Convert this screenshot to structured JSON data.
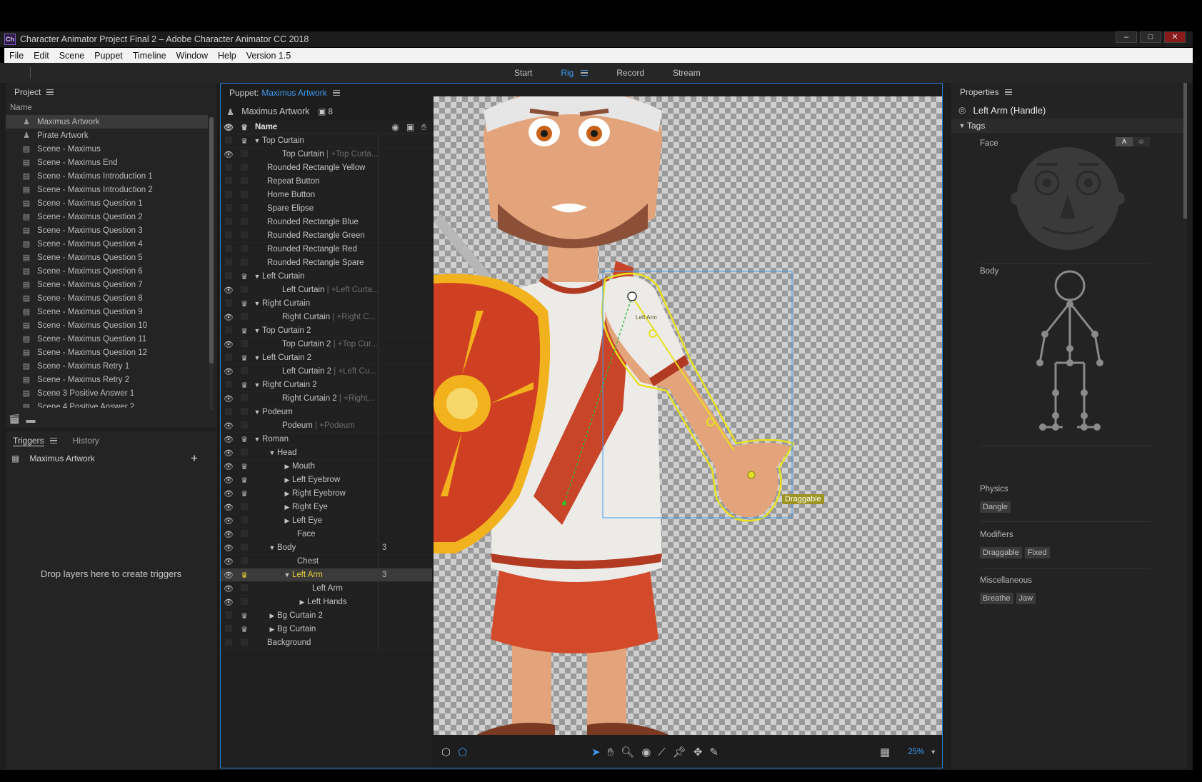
{
  "window": {
    "app_icon": "Ch",
    "title": "Character Animator Project Final 2 – Adobe Character Animator CC 2018",
    "controls": [
      "minimize-icon",
      "maximize-icon",
      "close-icon"
    ]
  },
  "menu": [
    "File",
    "Edit",
    "Scene",
    "Puppet",
    "Timeline",
    "Window",
    "Help",
    "Version 1.5"
  ],
  "workspaces": [
    {
      "label": "Start",
      "active": false
    },
    {
      "label": "Rig",
      "active": true
    },
    {
      "label": "Record",
      "active": false
    },
    {
      "label": "Stream",
      "active": false
    }
  ],
  "project": {
    "title": "Project",
    "column": "Name",
    "items": [
      {
        "label": "Maximus Artwork",
        "icon": "puppet-icon",
        "selected": true
      },
      {
        "label": "Pirate Artwork",
        "icon": "puppet-icon"
      },
      {
        "label": "Scene - Maximus",
        "icon": "scene-icon"
      },
      {
        "label": "Scene - Maximus End",
        "icon": "scene-icon"
      },
      {
        "label": "Scene - Maximus Introduction 1",
        "icon": "scene-icon"
      },
      {
        "label": "Scene - Maximus Introduction 2",
        "icon": "scene-icon"
      },
      {
        "label": "Scene - Maximus Question 1",
        "icon": "scene-icon"
      },
      {
        "label": "Scene - Maximus Question 2",
        "icon": "scene-icon"
      },
      {
        "label": "Scene - Maximus Question 3",
        "icon": "scene-icon"
      },
      {
        "label": "Scene - Maximus Question 4",
        "icon": "scene-icon"
      },
      {
        "label": "Scene - Maximus Question 5",
        "icon": "scene-icon"
      },
      {
        "label": "Scene - Maximus Question 6",
        "icon": "scene-icon"
      },
      {
        "label": "Scene - Maximus Question 7",
        "icon": "scene-icon"
      },
      {
        "label": "Scene - Maximus Question 8",
        "icon": "scene-icon"
      },
      {
        "label": "Scene - Maximus Question 9",
        "icon": "scene-icon"
      },
      {
        "label": "Scene - Maximus Question 10",
        "icon": "scene-icon"
      },
      {
        "label": "Scene - Maximus Question 11",
        "icon": "scene-icon"
      },
      {
        "label": "Scene - Maximus Question 12",
        "icon": "scene-icon"
      },
      {
        "label": "Scene - Maximus Retry 1",
        "icon": "scene-icon"
      },
      {
        "label": "Scene - Maximus Retry 2",
        "icon": "scene-icon"
      },
      {
        "label": "Scene 3 Positive Answer 1",
        "icon": "scene-icon"
      },
      {
        "label": "Scene 4 Positive Answer 2",
        "icon": "scene-icon"
      }
    ],
    "footer_icons": [
      "new-scene-icon",
      "folder-icon"
    ]
  },
  "triggers": {
    "tabs": [
      {
        "label": "Triggers",
        "active": true
      },
      {
        "label": "History",
        "active": false
      }
    ],
    "item": "Maximus Artwork",
    "hint": "Drop layers here to create triggers"
  },
  "puppet": {
    "title_prefix": "Puppet:",
    "name": "Maximus Artwork",
    "sub_name": "Maximus Artwork",
    "count": "8",
    "column_name": "Name",
    "layers": [
      {
        "label": "Top Curtain",
        "indent": 0,
        "caret": "open",
        "eye": false,
        "crown": true
      },
      {
        "label": "Top Curtain",
        "sub": "+Top Curta...",
        "indent": 2,
        "eye": true
      },
      {
        "label": "Rounded Rectangle Yellow",
        "indent": 1
      },
      {
        "label": "Repeat Button",
        "indent": 1
      },
      {
        "label": "Home Button",
        "indent": 1
      },
      {
        "label": "Spare Elipse",
        "indent": 1
      },
      {
        "label": "Rounded Rectangle Blue",
        "indent": 1
      },
      {
        "label": "Rounded Rectangle Green",
        "indent": 1
      },
      {
        "label": "Rounded Rectangle Red",
        "indent": 1
      },
      {
        "label": "Rounded Rectangle Spare",
        "indent": 1
      },
      {
        "label": "Left Curtain",
        "indent": 0,
        "caret": "open",
        "crown": true
      },
      {
        "label": "Left Curtain",
        "sub": "+Left Curta...",
        "indent": 2,
        "eye": true
      },
      {
        "label": "Right Curtain",
        "indent": 0,
        "caret": "open",
        "crown": true
      },
      {
        "label": "Right Curtain",
        "sub": "+Right C...",
        "indent": 2,
        "eye": true
      },
      {
        "label": "Top Curtain 2",
        "indent": 0,
        "caret": "open",
        "crown": true
      },
      {
        "label": "Top Curtain 2",
        "sub": "+Top Cur...",
        "indent": 2,
        "eye": true
      },
      {
        "label": "Left Curtain 2",
        "indent": 0,
        "caret": "open",
        "crown": true
      },
      {
        "label": "Left Curtain 2",
        "sub": "+Left Cu...",
        "indent": 2,
        "eye": true
      },
      {
        "label": "Right Curtain 2",
        "indent": 0,
        "caret": "open",
        "crown": true
      },
      {
        "label": "Right Curtain 2",
        "sub": "+Right...",
        "indent": 2,
        "eye": true
      },
      {
        "label": "Podeum",
        "indent": 0,
        "caret": "open"
      },
      {
        "label": "Podeum",
        "sub": "+Podeum",
        "indent": 2,
        "eye": true
      },
      {
        "label": "Roman",
        "indent": 0,
        "caret": "open",
        "eye": true,
        "crown": true
      },
      {
        "label": "Head",
        "indent": 1,
        "caret": "open",
        "eye": true
      },
      {
        "label": "Mouth",
        "indent": 2,
        "caret": "closed",
        "eye": true,
        "crown": true
      },
      {
        "label": "Left Eyebrow",
        "indent": 2,
        "caret": "closed",
        "eye": true,
        "crown": true
      },
      {
        "label": "Right Eyebrow",
        "indent": 2,
        "caret": "closed",
        "eye": true,
        "crown": true
      },
      {
        "label": "Right Eye",
        "indent": 2,
        "caret": "closed",
        "eye": true
      },
      {
        "label": "Left Eye",
        "indent": 2,
        "caret": "closed",
        "eye": true
      },
      {
        "label": "Face",
        "indent": 3,
        "eye": true
      },
      {
        "label": "Body",
        "indent": 1,
        "caret": "open",
        "eye": true,
        "num": "3"
      },
      {
        "label": "Chest",
        "indent": 3,
        "eye": true
      },
      {
        "label": "Left Arm",
        "indent": 2,
        "caret": "open",
        "eye": true,
        "crown": true,
        "crown_gold": true,
        "selected": true,
        "num": "3"
      },
      {
        "label": "Left Arm",
        "indent": 4,
        "eye": true
      },
      {
        "label": "Left Hands",
        "indent": 3,
        "caret": "closed",
        "eye": true
      },
      {
        "label": "Bg Curtain 2",
        "indent": 1,
        "caret": "closed",
        "crown": true
      },
      {
        "label": "Bg Curtain",
        "indent": 1,
        "caret": "closed",
        "crown": true
      },
      {
        "label": "Background",
        "indent": 1
      }
    ],
    "canvas": {
      "limb_label": "Left Arm",
      "handle_tag": "Draggable"
    },
    "toolbar": {
      "left": [
        "auto-rig-icon",
        "mesh-icon"
      ],
      "middle": [
        "select-icon",
        "hand-icon",
        "zoom-icon",
        "origin-icon",
        "stick-icon",
        "pin-icon",
        "dragger-icon",
        "path-icon"
      ],
      "zoom": "25%"
    }
  },
  "properties": {
    "title": "Properties",
    "selection": "Left Arm (Handle)",
    "tags_label": "Tags",
    "face_label": "Face",
    "face_toggle": [
      "A",
      "☺"
    ],
    "body_label": "Body",
    "physics_label": "Physics",
    "physics_chips": [
      "Dangle"
    ],
    "modifiers_label": "Modifiers",
    "modifiers_chips": [
      "Draggable",
      "Fixed"
    ],
    "misc_label": "Miscellaneous",
    "misc_chips": [
      "Breathe",
      "Jaw"
    ]
  },
  "colors": {
    "accent": "#3d9bf2",
    "handle_yellow": "#e8e020",
    "selection_gold": "#e8d23a"
  }
}
